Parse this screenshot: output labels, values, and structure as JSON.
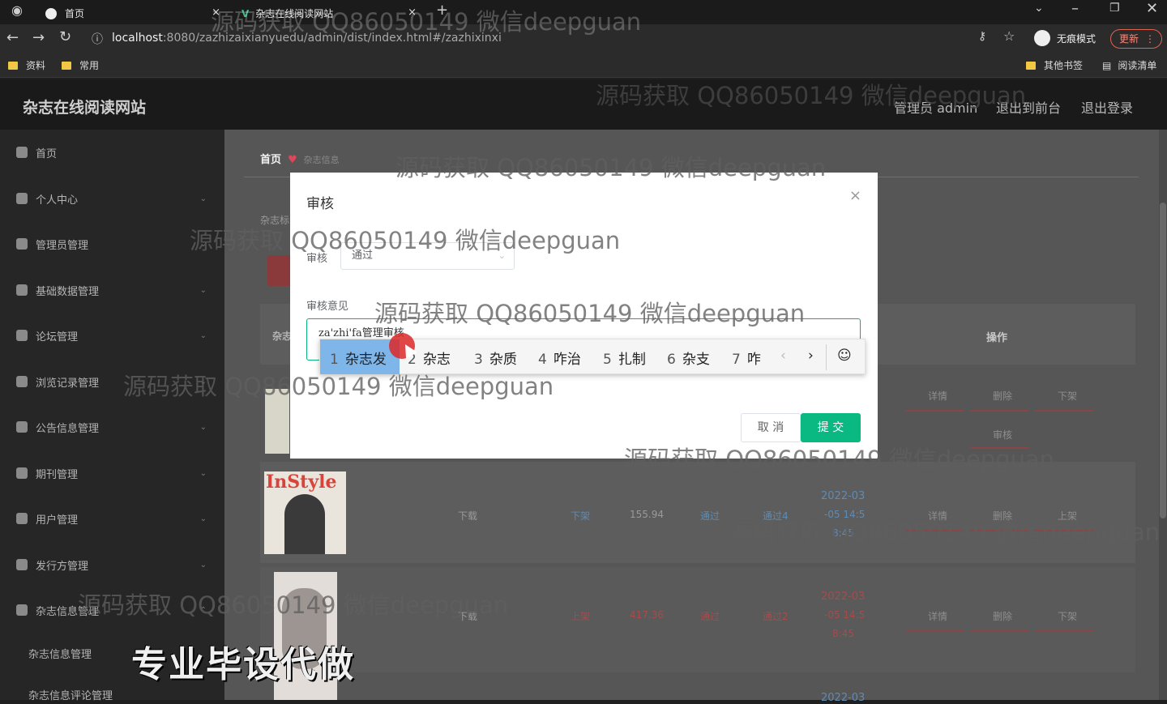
{
  "browser": {
    "tabs": [
      {
        "label": "首页"
      },
      {
        "label": "杂志在线阅读网站"
      }
    ],
    "new_tab": "+",
    "url_host": "localhost",
    "url_rest": ":8080/zazhizaixianyuedu/admin/dist/index.html#/zazhixinxi",
    "incognito_label": "无痕模式",
    "update_label": "更新",
    "bookmarks": [
      "资料",
      "常用"
    ],
    "other_bookmarks": "其他书签",
    "reading_list": "阅读清单"
  },
  "header": {
    "site_title": "杂志在线阅读网站",
    "admin_label": "管理员 admin",
    "to_front": "退出到前台",
    "logout": "退出登录"
  },
  "sidebar": {
    "items": [
      {
        "label": "首页",
        "icon": "home-icon"
      },
      {
        "label": "个人中心",
        "icon": "user-icon"
      },
      {
        "label": "管理员管理",
        "icon": "admin-icon"
      },
      {
        "label": "基础数据管理",
        "icon": "power-icon"
      },
      {
        "label": "论坛管理",
        "icon": "list-icon"
      },
      {
        "label": "浏览记录管理",
        "icon": "history-icon"
      },
      {
        "label": "公告信息管理",
        "icon": "grid-icon"
      },
      {
        "label": "期刊管理",
        "icon": "apps-icon"
      },
      {
        "label": "用户管理",
        "icon": "users-icon"
      },
      {
        "label": "发行方管理",
        "icon": "publisher-icon"
      },
      {
        "label": "杂志信息管理",
        "icon": "magazine-icon"
      }
    ],
    "subitems": [
      "杂志信息管理",
      "杂志信息评论管理"
    ]
  },
  "main": {
    "breadcrumb_home": "首页",
    "breadcrumb_current": "杂志信息",
    "filter_label": "杂志标",
    "table_col_1": "杂志",
    "ops_header": "操作",
    "rows": [
      {
        "download": "下载",
        "type": "下架",
        "price": "155.94",
        "status": "通过",
        "opinion": "通过4",
        "date": "2022-03",
        "time": "-05 14:5",
        "sec": "8:45",
        "actions": [
          "详情",
          "删除",
          "上架"
        ]
      },
      {
        "download": "下载",
        "type": "上架",
        "price": "417.36",
        "status": "通过",
        "opinion": "通过2",
        "date": "2022-03",
        "time": "-05 14:5",
        "sec": "8:45",
        "actions": [
          "详情",
          "删除",
          "下架"
        ]
      }
    ],
    "row0_actions": [
      "详情",
      "删除",
      "下架"
    ],
    "row0_audit": "审核",
    "cover_text": "InStyle",
    "bottom_date": "2022-03"
  },
  "dialog": {
    "title": "审核",
    "audit_label": "审核",
    "audit_value": "通过",
    "opinion_label": "审核意见",
    "opinion_value": "za'zhi'fa管理审核",
    "cancel": "取 消",
    "submit": "提 交"
  },
  "ime": {
    "candidates": [
      {
        "num": "1",
        "text": "杂志发"
      },
      {
        "num": "2",
        "text": "杂志"
      },
      {
        "num": "3",
        "text": "杂质"
      },
      {
        "num": "4",
        "text": "咋治"
      },
      {
        "num": "5",
        "text": "扎制"
      },
      {
        "num": "6",
        "text": "杂支"
      },
      {
        "num": "7",
        "text": "咋"
      }
    ]
  },
  "watermark": "源码获取 QQ86050149 微信deepguan",
  "promo": "专业毕设代做"
}
